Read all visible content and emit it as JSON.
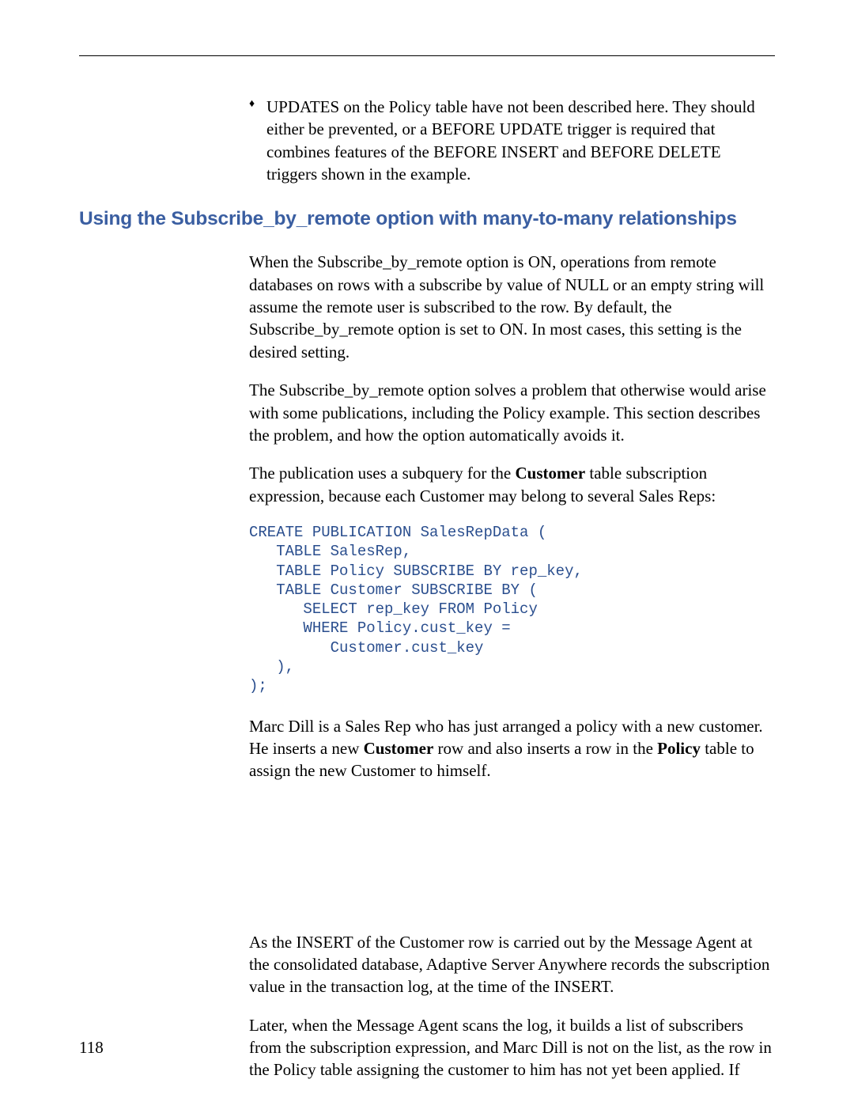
{
  "bullet1": "UPDATES on the Policy table have not been described here. They should either be prevented, or a BEFORE UPDATE trigger is required that combines features of the BEFORE INSERT and BEFORE DELETE triggers shown in the example.",
  "section_heading": "Using the Subscribe_by_remote option with many-to-many relationships",
  "para1": "When the Subscribe_by_remote option is ON, operations from remote databases on rows with a subscribe by value of NULL or an empty string will assume the remote user is subscribed to the row. By default, the Subscribe_by_remote option is set to ON. In most cases, this setting is the desired setting.",
  "para2": "The Subscribe_by_remote option solves a problem that otherwise would arise with some publications, including the Policy example. This section describes the problem, and how the option automatically avoids it.",
  "para3_a": "The publication uses a subquery for the ",
  "para3_b_bold": "Customer",
  "para3_c": " table subscription expression, because each Customer may belong to several Sales Reps:",
  "code": "CREATE PUBLICATION SalesRepData (\n   TABLE SalesRep,\n   TABLE Policy SUBSCRIBE BY rep_key,\n   TABLE Customer SUBSCRIBE BY (\n      SELECT rep_key FROM Policy\n      WHERE Policy.cust_key =\n         Customer.cust_key\n   ),\n);",
  "para4_a": "Marc Dill is a Sales Rep who has just arranged a policy with a new customer. He inserts a new ",
  "para4_b_bold": "Customer",
  "para4_c": " row and also inserts a row in the ",
  "para4_d_bold": "Policy",
  "para4_e": " table to assign the new Customer to himself.",
  "para5": "As the INSERT of the Customer row is carried out by the Message Agent at the consolidated database, Adaptive Server Anywhere records the subscription value in the transaction log, at the time of the INSERT.",
  "para6": "Later, when the Message Agent scans the log, it builds a list of subscribers from the subscription expression, and Marc Dill is not on the list, as the row in the Policy table assigning the customer to him has not yet been applied. If",
  "page_number": "118"
}
